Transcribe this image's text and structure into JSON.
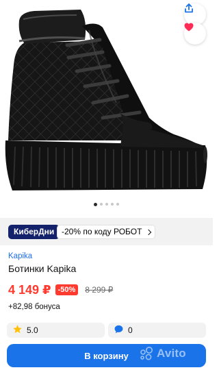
{
  "product": {
    "brand": "Kapika",
    "title": "Ботинки Kapika",
    "price": "4 149 ₽",
    "discount": "-50%",
    "old_price": "8 299 ₽",
    "bonus": "+82,98 бонуса",
    "rating": "5.0",
    "comments": "0"
  },
  "gallery": {
    "slides_total": 5,
    "active_index": 0
  },
  "promo": {
    "badge": "КиберДни",
    "code_text": "-20% по коду РОБОТ"
  },
  "cart_button_label": "В корзину",
  "watermark": "Avito",
  "colors": {
    "accent_blue": "#1a73e8",
    "price_red": "#ff3b30",
    "badge_navy": "#13226a",
    "heart_red": "#ff2d55",
    "star_yellow": "#ffc107"
  },
  "icons": [
    "share-icon",
    "heart-icon",
    "star-icon",
    "comment-icon",
    "chevron-right-icon"
  ]
}
